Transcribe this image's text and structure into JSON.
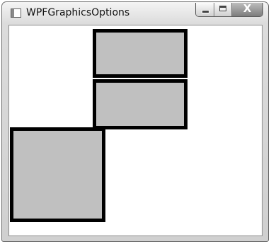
{
  "window": {
    "title": "WPFGraphicsOptions",
    "app_icon": "window-icon",
    "controls": [
      {
        "name": "minimize",
        "icon": "minimize-icon"
      },
      {
        "name": "maximize",
        "icon": "maximize-icon"
      },
      {
        "name": "close",
        "icon": "close-icon",
        "glyph": "X"
      }
    ]
  },
  "canvas": {
    "background_color": "#ffffff",
    "shape_fill_color": "#c0c0c0",
    "shape_stroke_color": "#000000",
    "shapes": [
      "top-rectangle",
      "middle-rectangle",
      "bottom-left-rectangle"
    ]
  }
}
